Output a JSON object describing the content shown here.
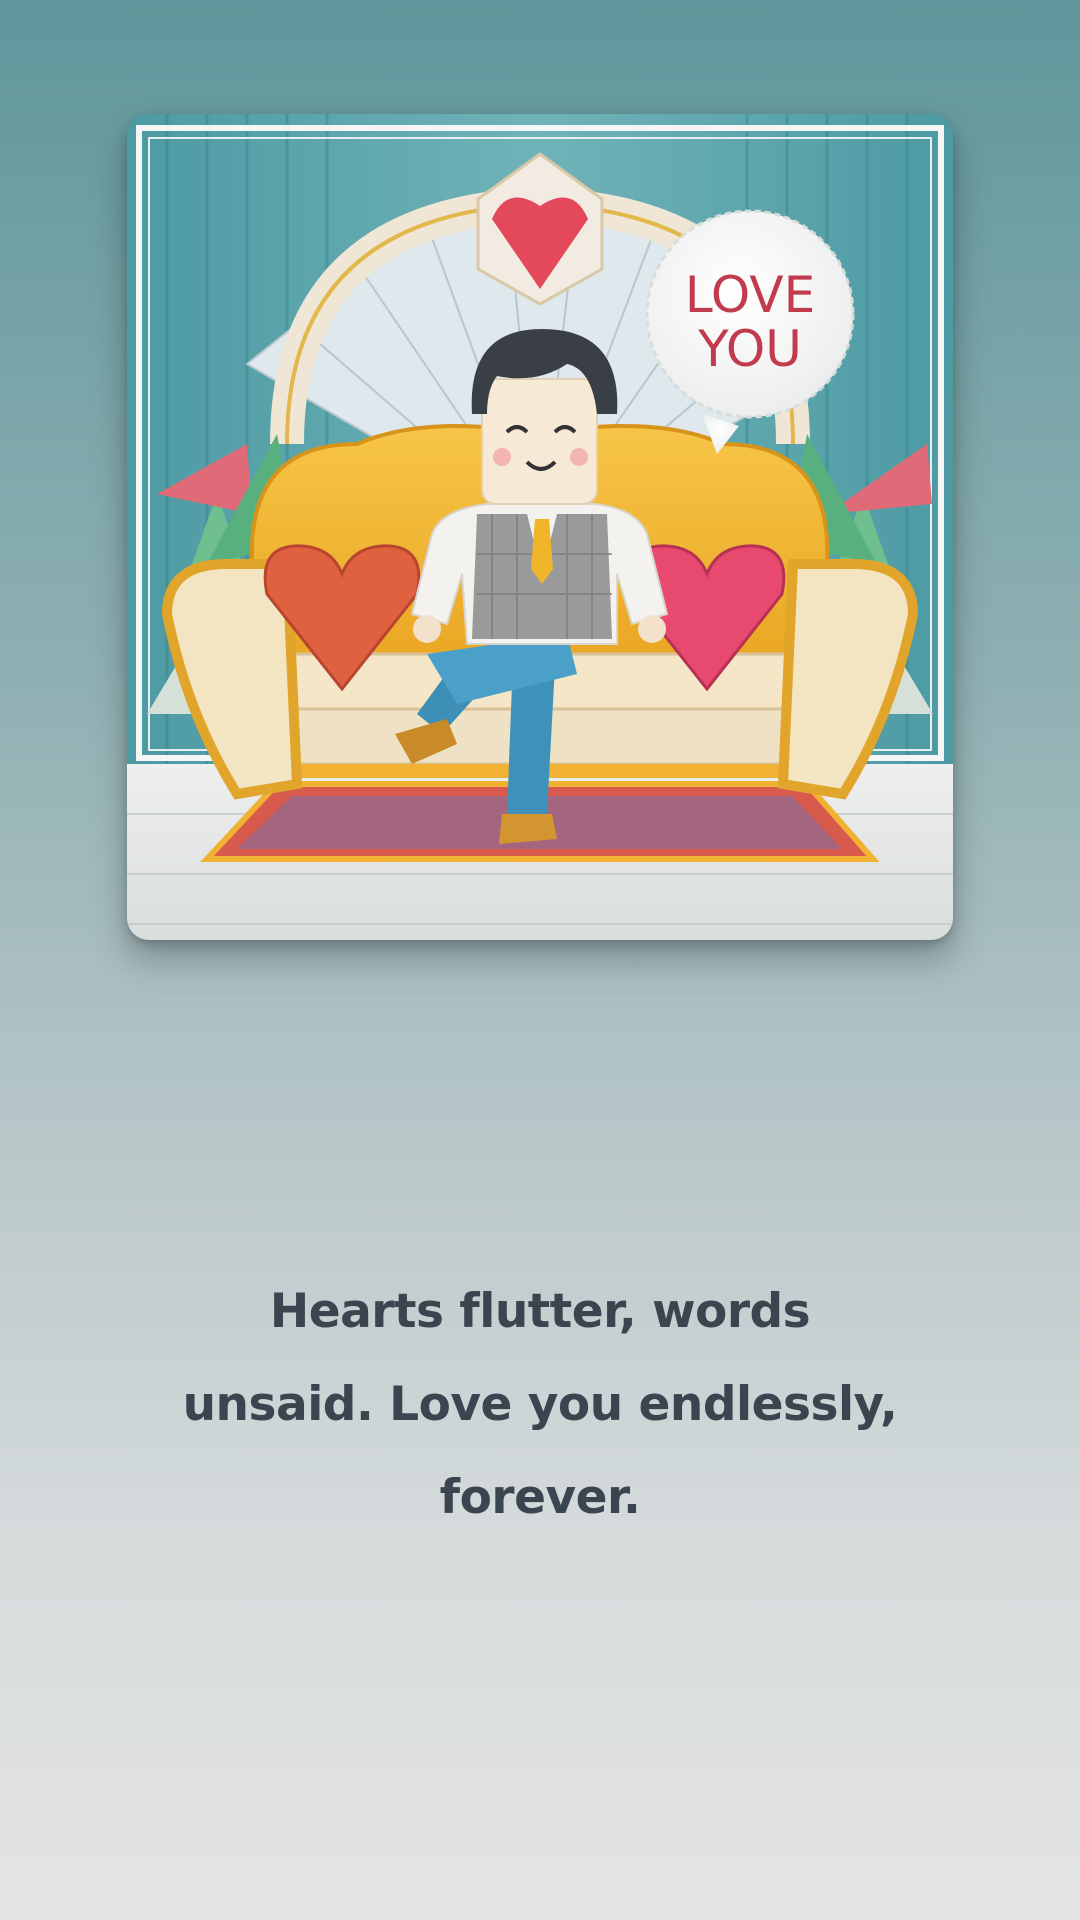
{
  "card": {
    "speech_bubble_text_line1": "LOVE",
    "speech_bubble_text_line2": "YOU"
  },
  "quote": {
    "line1": "Hearts flutter, words",
    "line2": "unsaid. Love you endlessly,",
    "line3": "forever."
  },
  "colors": {
    "background_top": "#5f979c",
    "background_bottom": "#e4e4e4",
    "quote_text": "#3a454f",
    "sofa": "#f2b233",
    "speech_text": "#c23a4e"
  }
}
